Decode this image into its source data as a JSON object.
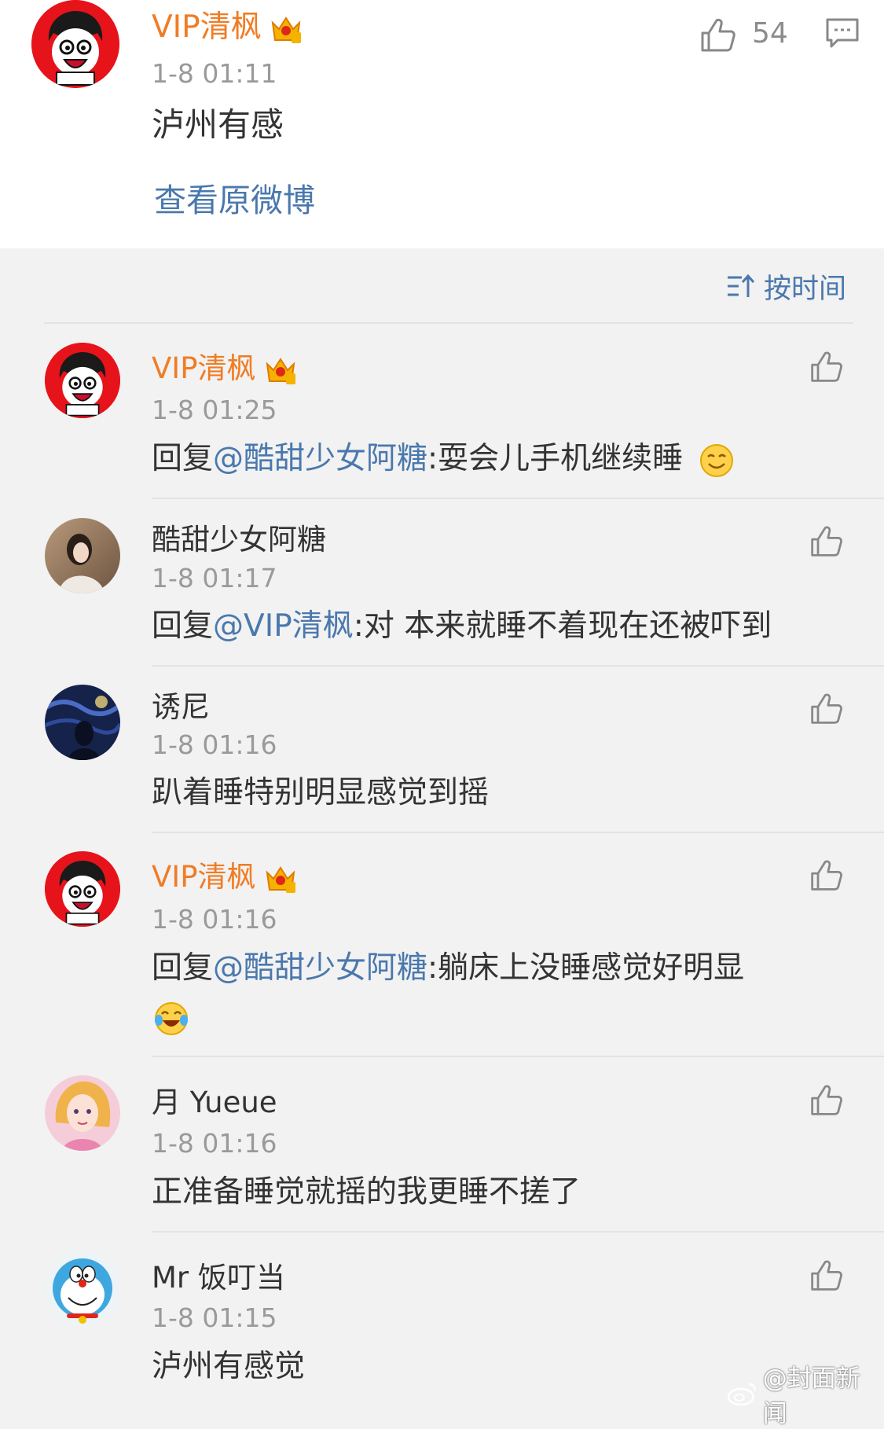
{
  "post": {
    "username": "VIP清枫",
    "timestamp": "1-8 01:11",
    "text": "泸州有感",
    "like_count": "54",
    "view_original": "查看原微博"
  },
  "sort": {
    "label": "按时间"
  },
  "comments": [
    {
      "username": "VIP清枫",
      "timestamp": "1-8 01:25",
      "reply_prefix": "回复",
      "mention": "@酷甜少女阿糖",
      "text": ":耍会儿手机继续睡",
      "emoji": "smile-emoji"
    },
    {
      "username": "酷甜少女阿糖",
      "timestamp": "1-8 01:17",
      "reply_prefix": "回复",
      "mention": "@VIP清枫",
      "text": ":对 本来就睡不着现在还被吓到"
    },
    {
      "username": "诱尼",
      "timestamp": "1-8 01:16",
      "text": "趴着睡特别明显感觉到摇"
    },
    {
      "username": "VIP清枫",
      "timestamp": "1-8 01:16",
      "reply_prefix": "回复",
      "mention": "@酷甜少女阿糖",
      "text": ":躺床上没睡感觉好明显",
      "emoji": "laugh-cry-emoji"
    },
    {
      "username": "月 Yueue",
      "timestamp": "1-8 01:16",
      "text": "正准备睡觉就摇的我更睡不搓了"
    },
    {
      "username": "Mr 饭叮当",
      "timestamp": "1-8 01:15",
      "text": "泸州有感觉"
    }
  ],
  "watermark": "@封面新闻",
  "colors": {
    "vip_name": "#f07c24",
    "link": "#4a78ad",
    "timestamp": "#9a9a9a",
    "text": "#333333"
  }
}
